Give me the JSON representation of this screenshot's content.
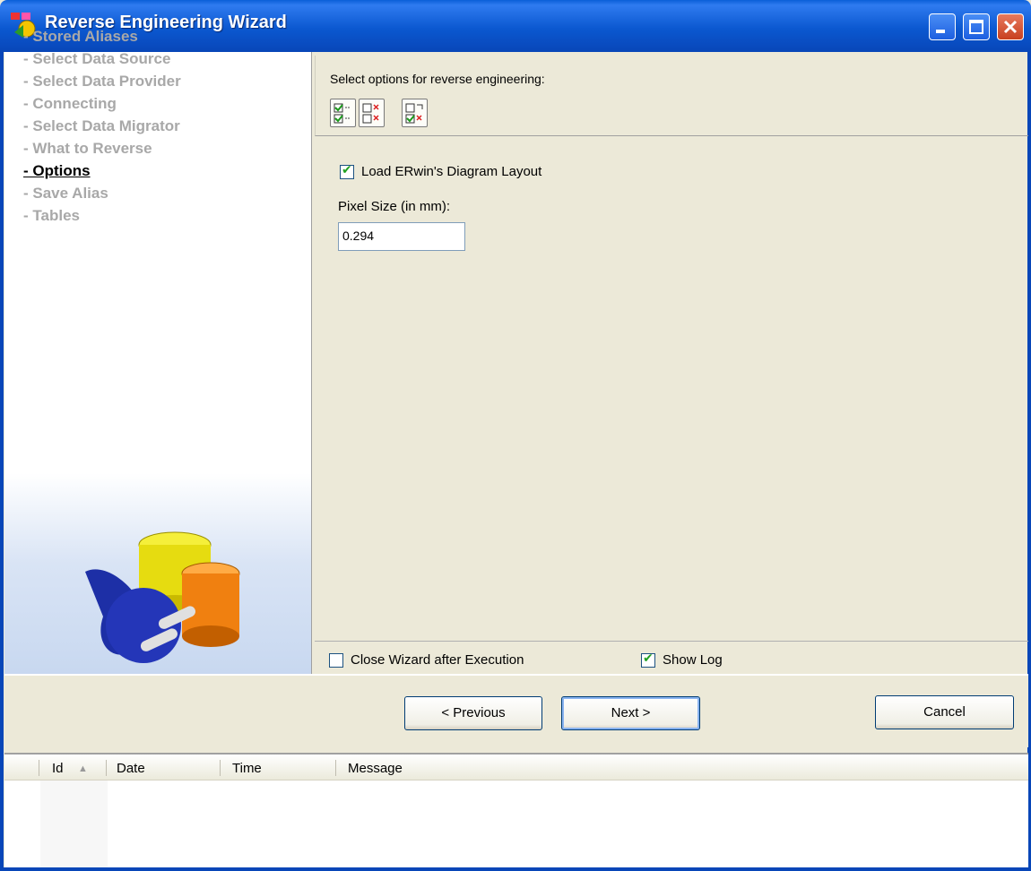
{
  "window": {
    "title": "Reverse Engineering Wizard",
    "colors": {
      "titlebar": "#0b58d0",
      "close": "#c8401f"
    }
  },
  "nav": {
    "items": [
      "- Stored Aliases",
      "- Select Data Source",
      "- Select Data Provider",
      "- Connecting",
      "- Select Data Migrator",
      "- What to Reverse",
      "- Options",
      "- Save Alias",
      "- Tables"
    ],
    "active_index": 6
  },
  "options": {
    "header": "Select options for reverse engineering:",
    "toolbar_icons": [
      "check-all-icon",
      "uncheck-all-icon",
      "invert-selection-icon"
    ],
    "load_layout": {
      "label": "Load ERwin's Diagram Layout",
      "checked": true
    },
    "pixel_size": {
      "label": "Pixel Size (in mm):",
      "value": "0.294"
    },
    "close_wizard": {
      "label": "Close Wizard after Execution",
      "checked": false
    },
    "show_log": {
      "label": "Show Log",
      "checked": true
    }
  },
  "buttons": {
    "previous": "< Previous",
    "next": "Next >",
    "cancel": "Cancel"
  },
  "log": {
    "columns": [
      "Id",
      "Date",
      "Time",
      "Message"
    ],
    "sort_indicator": "▲"
  }
}
